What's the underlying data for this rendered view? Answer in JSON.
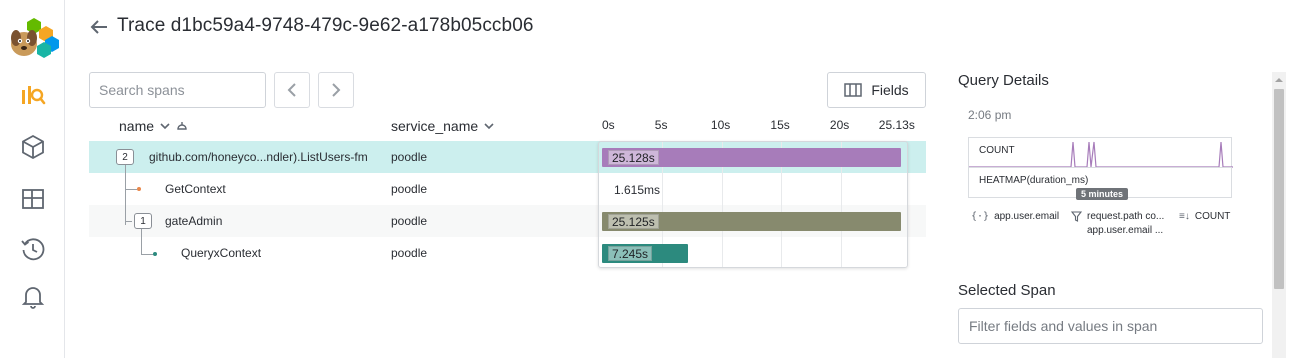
{
  "header": {
    "title": "Trace d1bc59a4-9748-479c-9e62-a178b05ccb06"
  },
  "toolbar": {
    "search_placeholder": "Search spans",
    "fields_label": "Fields"
  },
  "columns": {
    "name": "name",
    "service": "service_name"
  },
  "timeline": {
    "ticks": [
      "0s",
      "5s",
      "10s",
      "15s",
      "20s",
      "25.13s"
    ],
    "total_s": 25.13
  },
  "spans": [
    {
      "count": "2",
      "name": "github.com/honeyco...ndler).ListUsers-fm",
      "service": "poodle",
      "duration_label": "25.128s",
      "duration_s": 25.128,
      "color": "#a77cba"
    },
    {
      "name": "GetContext",
      "service": "poodle",
      "duration_label": "1.615ms",
      "duration_s": 0.001615,
      "color": "#e8874a"
    },
    {
      "count": "1",
      "name": "gateAdmin",
      "service": "poodle",
      "duration_label": "25.125s",
      "duration_s": 25.125,
      "color": "#878a6e"
    },
    {
      "name": "QueryxContext",
      "service": "poodle",
      "duration_label": "7.245s",
      "duration_s": 7.245,
      "color": "#2c8a7e"
    }
  ],
  "query_details": {
    "title": "Query Details",
    "time": "2:06 pm",
    "count_label": "COUNT",
    "heatmap_label": "HEATMAP(duration_ms)",
    "tooltip": "5 minutes",
    "group_by": "app.user.email",
    "filter": "request.path co...",
    "filter_sub": "app.user.email ...",
    "order": "COUNT"
  },
  "selected_span": {
    "title": "Selected Span",
    "filter_placeholder": "Filter fields and values in span"
  },
  "colors": {
    "accent": "#f5a623",
    "selected_row": "#ccefee"
  }
}
